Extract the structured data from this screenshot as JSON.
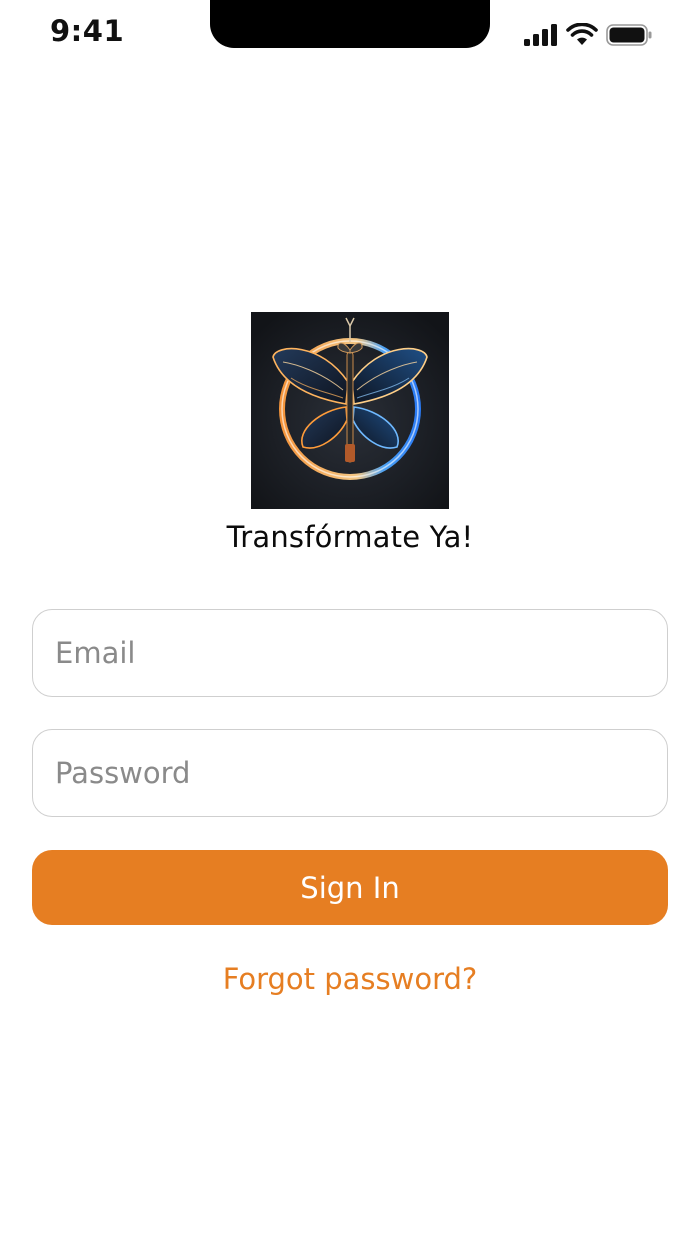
{
  "status_bar": {
    "time": "9:41",
    "icons": [
      "cellular-signal-icon",
      "wifi-icon",
      "battery-icon"
    ]
  },
  "app": {
    "logo": "butterfly-logo",
    "title": "Transfórmate Ya!"
  },
  "form": {
    "email": {
      "value": "",
      "placeholder": "Email"
    },
    "password": {
      "value": "",
      "placeholder": "Password"
    },
    "sign_in_label": "Sign In",
    "forgot_label": "Forgot password?"
  },
  "colors": {
    "accent": "#E67E22",
    "field_border": "#CFCFCF",
    "placeholder": "#8A8A8A"
  }
}
